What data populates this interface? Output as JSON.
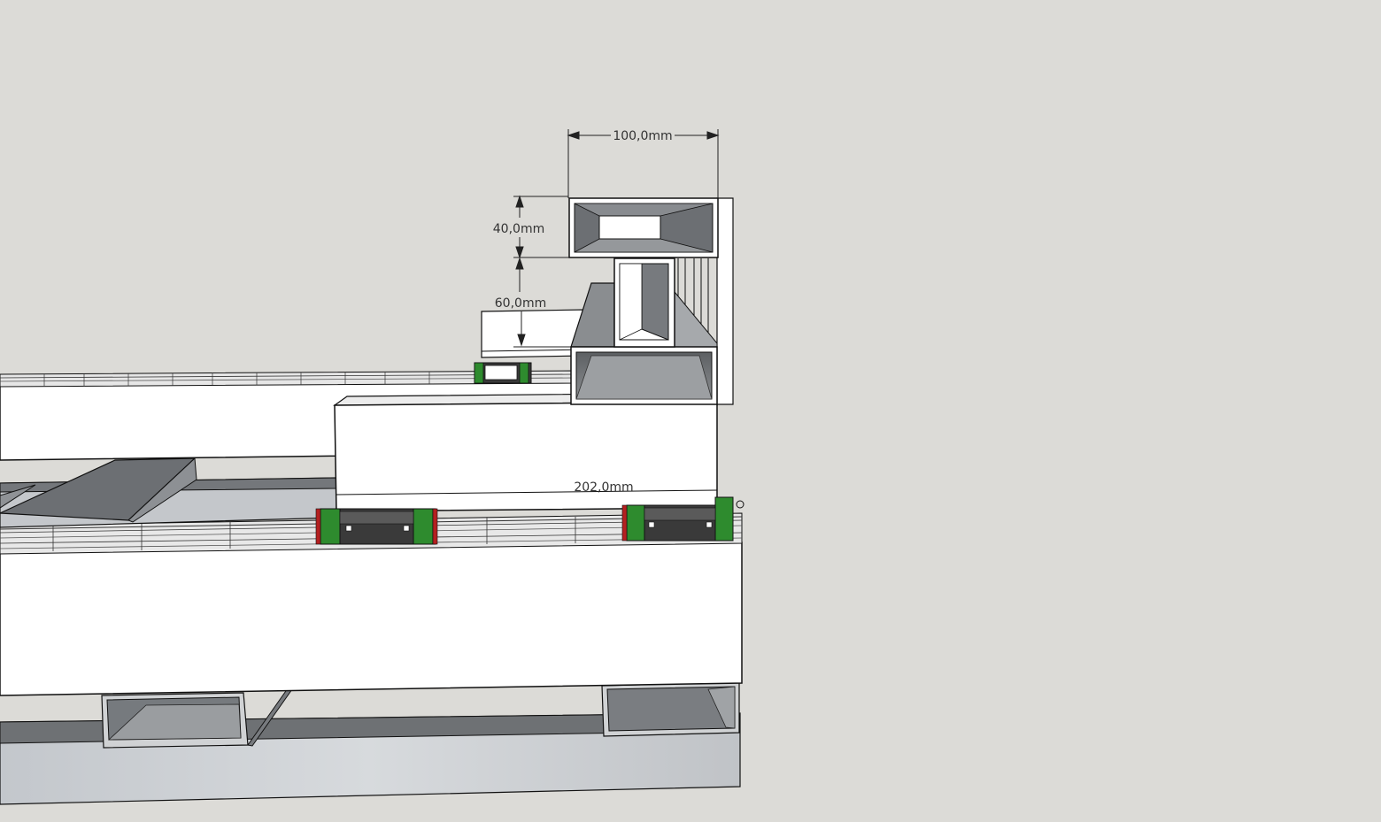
{
  "dimensions": {
    "width_top": "100,0mm",
    "height_top_tube": "40,0mm",
    "height_gap": "60,0mm",
    "carriage_length": "202,0mm"
  },
  "colors": {
    "background": "#dcdbd7",
    "face_white": "#ffffff",
    "steel_dark": "#6f7275",
    "steel_mid": "#9a9da0",
    "steel_light": "#c9cbcd",
    "outline": "#111111",
    "bearing_green": "#2e8b2e",
    "bearing_red": "#b42020",
    "bearing_body": "#3a3a3a"
  }
}
